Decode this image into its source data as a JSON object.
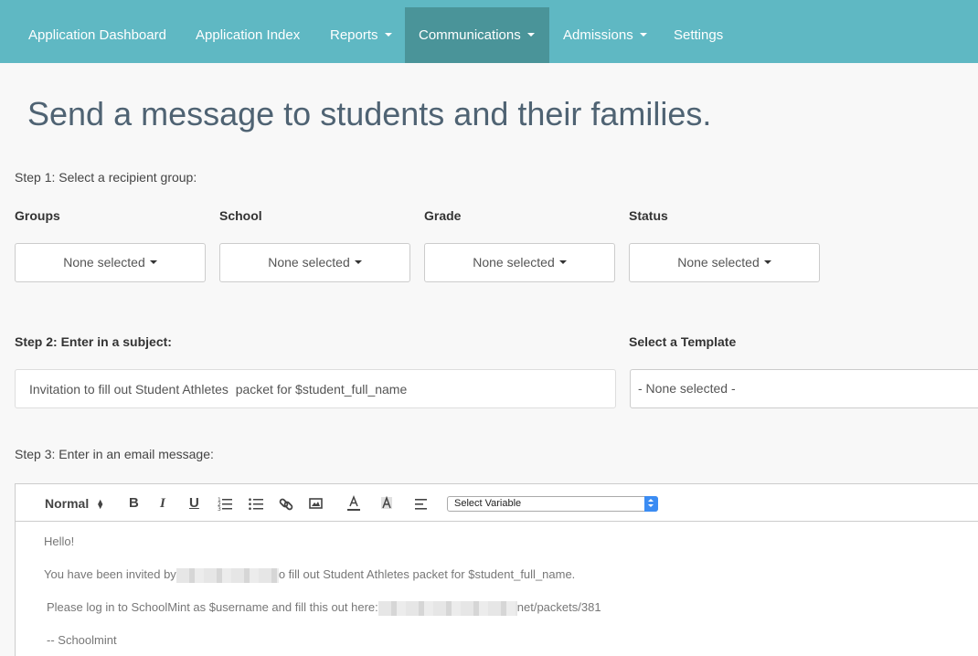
{
  "nav": {
    "items": [
      {
        "label": "Application Dashboard"
      },
      {
        "label": "Application Index"
      },
      {
        "label": "Reports"
      },
      {
        "label": "Communications"
      },
      {
        "label": "Admissions"
      },
      {
        "label": "Settings"
      }
    ]
  },
  "page": {
    "title": "Send a message to students and their families."
  },
  "step1": {
    "label": "Step 1: Select a recipient group:",
    "filters": [
      {
        "label": "Groups",
        "value": "None selected"
      },
      {
        "label": "School",
        "value": "None selected"
      },
      {
        "label": "Grade",
        "value": "None selected"
      },
      {
        "label": "Status",
        "value": "None selected"
      }
    ]
  },
  "step2": {
    "label": "Step 2: Enter in a subject:",
    "subject_value": "Invitation to fill out Student Athletes  packet for $student_full_name",
    "template_label": "Select a Template",
    "template_value": "- None selected -"
  },
  "step3": {
    "label": "Step 3: Enter in an email message:",
    "toolbar": {
      "format_value": "Normal",
      "variable_placeholder": "Select Variable"
    },
    "message": {
      "line1": "Hello!",
      "line2_before": "You have been invited by",
      "line2_after": "o fill out Student Athletes  packet for $student_full_name.",
      "line3_before": "Please log in to SchoolMint as $username and fill this out here:",
      "line3_after": "net/packets/381",
      "line4": "-- Schoolmint"
    }
  }
}
